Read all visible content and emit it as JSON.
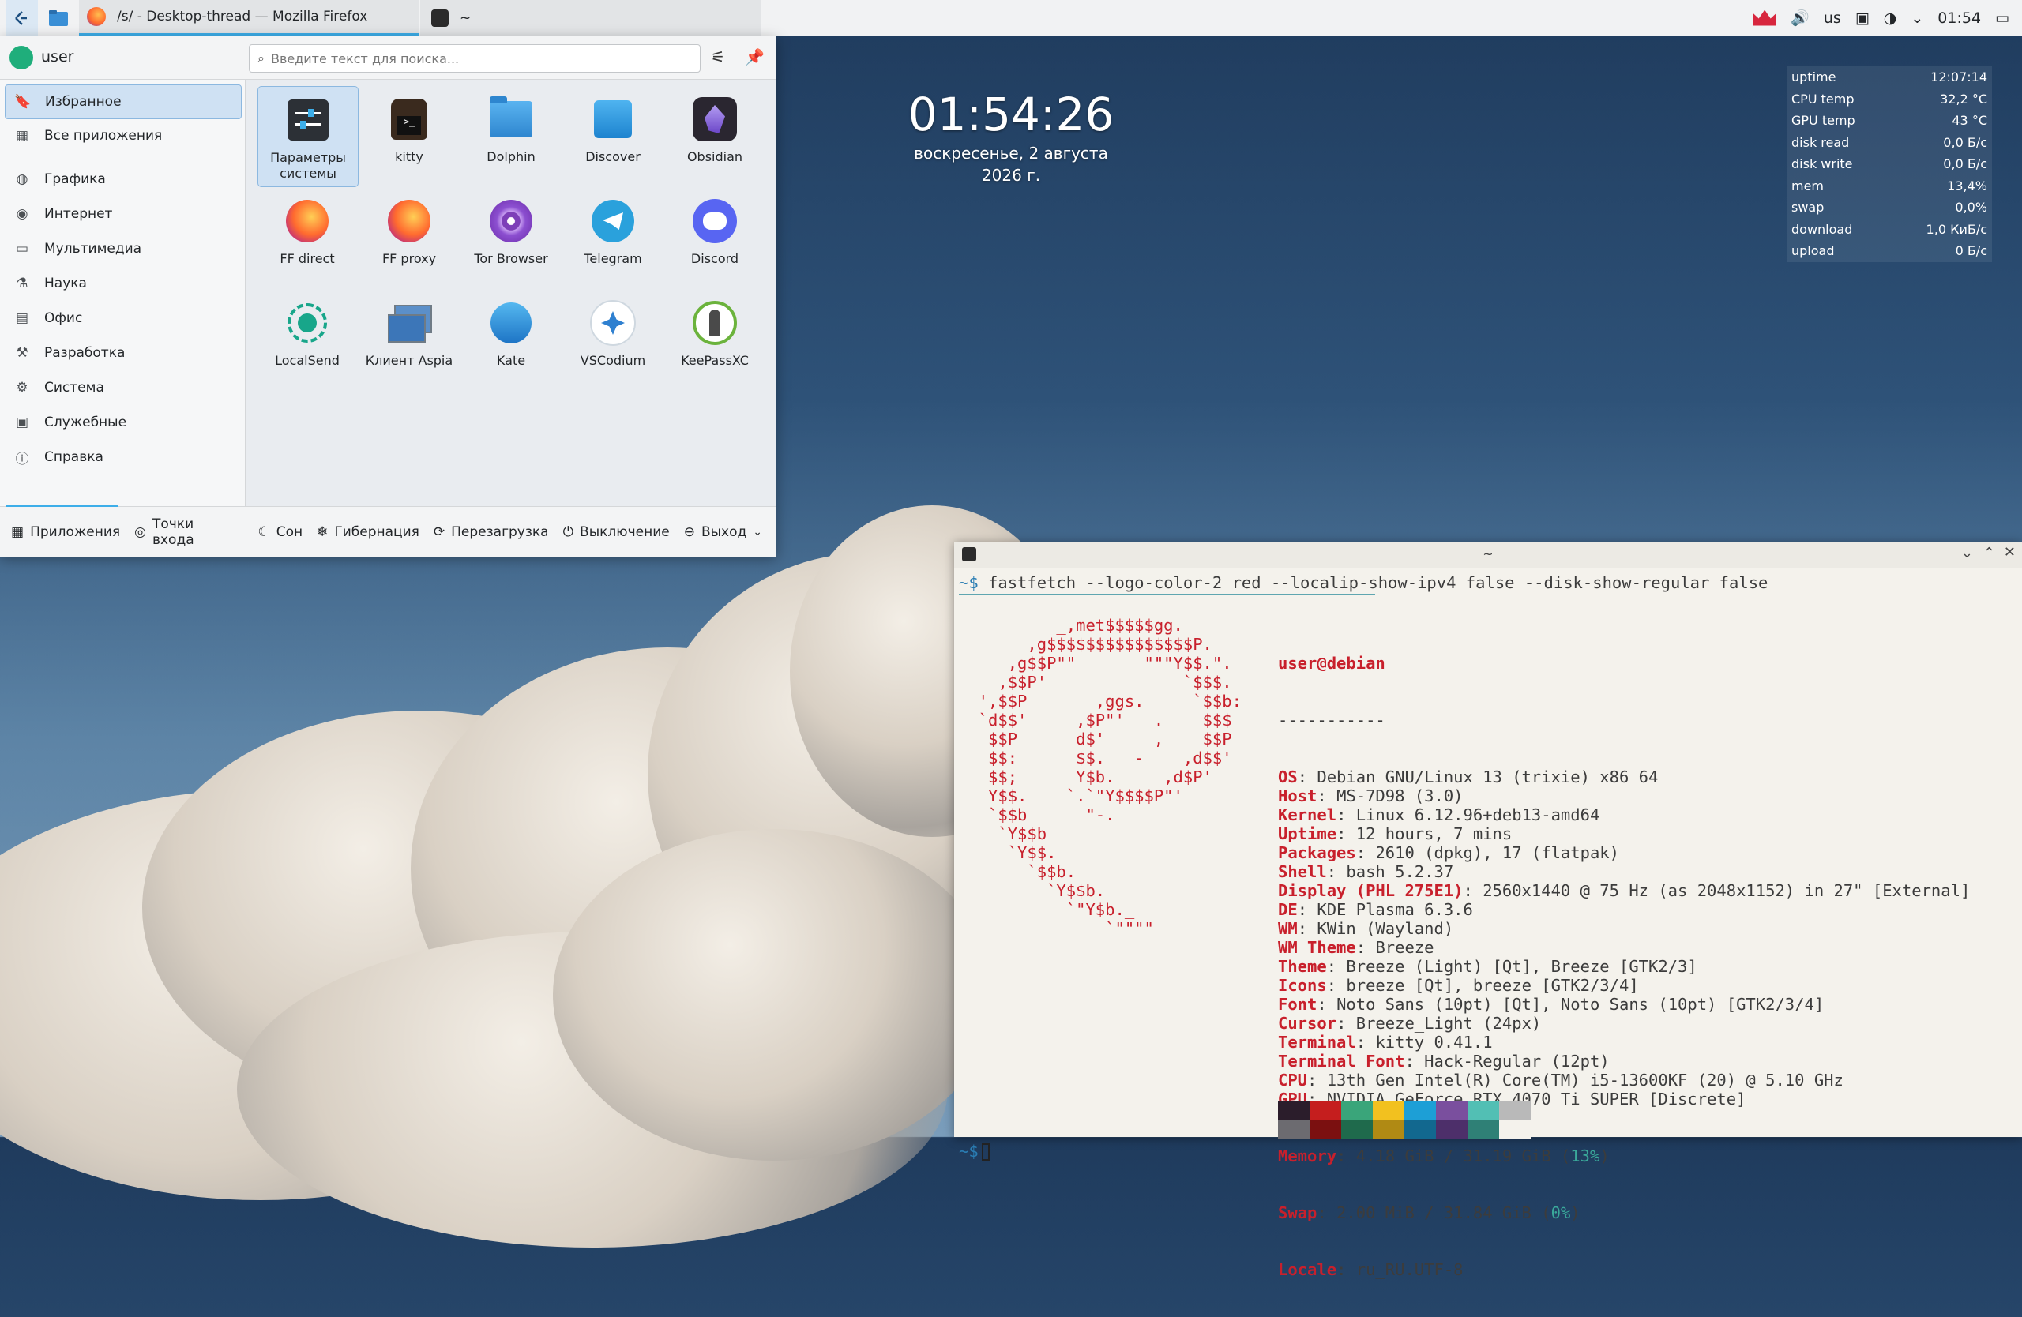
{
  "taskbar": {
    "tasks": [
      {
        "label": "/s/ - Desktop-thread — Mozilla Firefox"
      },
      {
        "label": "~"
      }
    ],
    "tray": {
      "keyboard": "us",
      "time": "01:54"
    }
  },
  "launcher": {
    "user": "user",
    "search_placeholder": "Введите текст для поиска...",
    "categories": [
      {
        "label": "Избранное",
        "icon": "bookmark-icon"
      },
      {
        "label": "Все приложения",
        "icon": "grid-icon"
      },
      {
        "label": "Графика",
        "icon": "graphics-icon"
      },
      {
        "label": "Интернет",
        "icon": "globe-icon"
      },
      {
        "label": "Мультимедиа",
        "icon": "multimedia-icon"
      },
      {
        "label": "Наука",
        "icon": "flask-icon"
      },
      {
        "label": "Офис",
        "icon": "office-icon"
      },
      {
        "label": "Разработка",
        "icon": "hammer-icon"
      },
      {
        "label": "Система",
        "icon": "gear-icon"
      },
      {
        "label": "Служебные",
        "icon": "toolbox-icon"
      },
      {
        "label": "Справка",
        "icon": "info-icon"
      }
    ],
    "apps": [
      {
        "label": "Параметры системы",
        "icon": "settings-icon"
      },
      {
        "label": "kitty",
        "icon": "kitty-icon"
      },
      {
        "label": "Dolphin",
        "icon": "folder-icon"
      },
      {
        "label": "Discover",
        "icon": "discover-icon"
      },
      {
        "label": "Obsidian",
        "icon": "obsidian-icon"
      },
      {
        "label": "FF direct",
        "icon": "firefox-icon"
      },
      {
        "label": "FF proxy",
        "icon": "firefox-icon"
      },
      {
        "label": "Tor Browser",
        "icon": "tor-icon"
      },
      {
        "label": "Telegram",
        "icon": "telegram-icon"
      },
      {
        "label": "Discord",
        "icon": "discord-icon"
      },
      {
        "label": "LocalSend",
        "icon": "localsend-icon"
      },
      {
        "label": "Клиент Aspia",
        "icon": "aspia-icon"
      },
      {
        "label": "Kate",
        "icon": "kate-icon"
      },
      {
        "label": "VSCodium",
        "icon": "vscodium-icon"
      },
      {
        "label": "KeePassXC",
        "icon": "keepassxc-icon"
      }
    ],
    "footer": {
      "applications": "Приложения",
      "places": "Точки входа",
      "sleep": "Сон",
      "hibernate": "Гибернация",
      "reboot": "Перезагрузка",
      "shutdown": "Выключение",
      "logout": "Выход"
    }
  },
  "clock": {
    "time": "01:54:26",
    "date": "воскресенье, 2 августа",
    "year": "2026 г."
  },
  "sysmon": [
    {
      "label": "uptime",
      "value": "12:07:14"
    },
    {
      "label": "CPU temp",
      "value": "32,2 °C"
    },
    {
      "label": "GPU temp",
      "value": "43 °C"
    },
    {
      "label": "disk read",
      "value": "0,0 Б/с"
    },
    {
      "label": "disk write",
      "value": "0,0 Б/с"
    },
    {
      "label": "mem",
      "value": "13,4%"
    },
    {
      "label": "swap",
      "value": "0,0%"
    },
    {
      "label": "download",
      "value": "1,0 КиБ/с"
    },
    {
      "label": "upload",
      "value": "0 Б/с"
    }
  ],
  "terminal": {
    "title": "~",
    "prompt": "~$",
    "command": "fastfetch --logo-color-2 red --localip-show-ipv4 false --disk-show-regular false",
    "user_host": "user@debian",
    "separator": "-----------",
    "info": [
      {
        "k": "OS",
        "v": "Debian GNU/Linux 13 (trixie) x86_64"
      },
      {
        "k": "Host",
        "v": "MS-7D98 (3.0)"
      },
      {
        "k": "Kernel",
        "v": "Linux 6.12.96+deb13-amd64"
      },
      {
        "k": "Uptime",
        "v": "12 hours, 7 mins"
      },
      {
        "k": "Packages",
        "v": "2610 (dpkg), 17 (flatpak)"
      },
      {
        "k": "Shell",
        "v": "bash 5.2.37"
      },
      {
        "k": "Display (PHL 275E1)",
        "v": "2560x1440 @ 75 Hz (as 2048x1152) in 27\" [External]"
      },
      {
        "k": "DE",
        "v": "KDE Plasma 6.3.6"
      },
      {
        "k": "WM",
        "v": "KWin (Wayland)"
      },
      {
        "k": "WM Theme",
        "v": "Breeze"
      },
      {
        "k": "Theme",
        "v": "Breeze (Light) [Qt], Breeze [GTK2/3]"
      },
      {
        "k": "Icons",
        "v": "breeze [Qt], breeze [GTK2/3/4]"
      },
      {
        "k": "Font",
        "v": "Noto Sans (10pt) [Qt], Noto Sans (10pt) [GTK2/3/4]"
      },
      {
        "k": "Cursor",
        "v": "Breeze_Light (24px)"
      },
      {
        "k": "Terminal",
        "v": "kitty 0.41.1"
      },
      {
        "k": "Terminal Font",
        "v": "Hack-Regular (12pt)"
      },
      {
        "k": "CPU",
        "v": "13th Gen Intel(R) Core(TM) i5-13600KF (20) @ 5.10 GHz"
      },
      {
        "k": "GPU",
        "v": "NVIDIA GeForce RTX 4070 Ti SUPER [Discrete]"
      }
    ],
    "memory": {
      "k": "Memory",
      "v": "4.18 GiB / 31.19 GiB",
      "pct": "13%"
    },
    "swap": {
      "k": "Swap",
      "v": "2.00 MiB / 31.84 GiB",
      "pct": "0%"
    },
    "locale": {
      "k": "Locale",
      "v": "ru_RU.UTF-8"
    },
    "logo": [
      "          _,met$$$$$gg.",
      "       ,g$$$$$$$$$$$$$$$P.",
      "     ,g$$P\"\"       \"\"\"Y$$.\".",
      "    ,$$P'              `$$$.",
      "  ',$$P       ,ggs.     `$$b:",
      "  `d$$'     ,$P\"'   .    $$$",
      "   $$P      d$'     ,    $$P",
      "   $$:      $$.   -    ,d$$'",
      "   $$;      Y$b._   _,d$P'",
      "   Y$$.    `.`\"Y$$$$P\"'",
      "   `$$b      \"-.__",
      "    `Y$$b",
      "     `Y$$.",
      "       `$$b.",
      "         `Y$$b.",
      "           `\"Y$b._",
      "               `\"\"\"\""
    ],
    "palette_top": [
      "#2b1d2b",
      "#c51e1e",
      "#3aa57a",
      "#f2c11f",
      "#1d9fd6",
      "#7a4f9e",
      "#52bfb4",
      "#b9b9b9"
    ],
    "palette_bottom": [
      "#6c6b70",
      "#7b1010",
      "#1f6a4c",
      "#b08a14",
      "#12688f",
      "#4d2f6a",
      "#2f8076",
      "#f4f2ec"
    ]
  }
}
